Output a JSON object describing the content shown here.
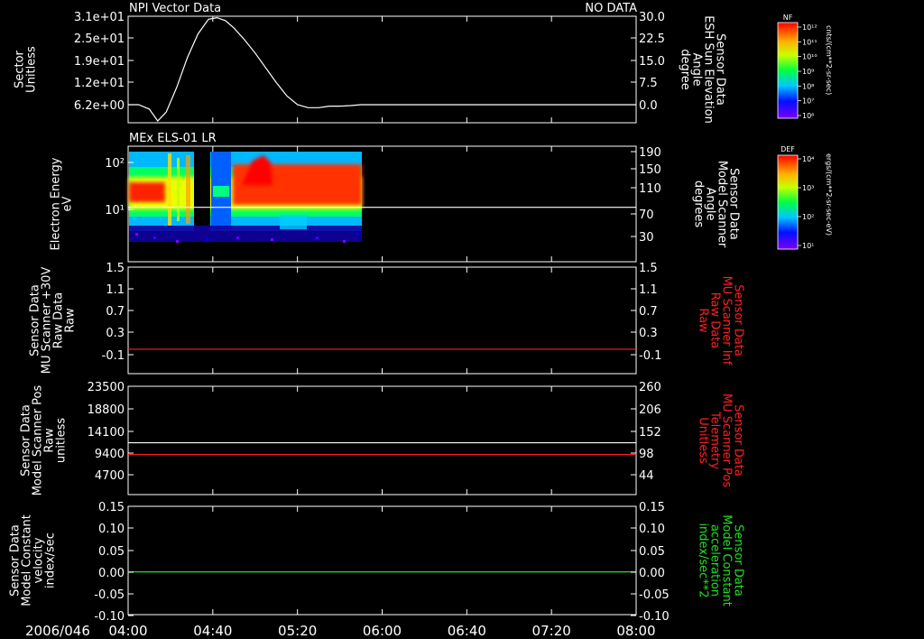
{
  "footer": {
    "date": "2006/046",
    "time_ticks": [
      "04:00",
      "04:40",
      "05:20",
      "06:00",
      "06:40",
      "07:20",
      "08:00"
    ]
  },
  "panels": [
    {
      "id": "panel1",
      "title_left": "NPI Vector Data",
      "title_right": "NO DATA",
      "left_axis": {
        "label": [
          "Sector",
          "Unitless"
        ],
        "ticks": [
          "3.1e+01",
          "2.5e+01",
          "1.9e+01",
          "1.2e+01",
          "6.2e+00"
        ],
        "color": "#ffffff"
      },
      "right_axis": {
        "label": [
          "Sensor Data",
          "ESH Sun Elevation",
          "Angle",
          "degree"
        ],
        "ticks": [
          "30.0",
          "22.5",
          "15.0",
          "7.5",
          "0.0"
        ],
        "color": "#ffffff"
      }
    },
    {
      "id": "panel2",
      "title_left": "MEx ELS-01 LR",
      "left_axis": {
        "label": [
          "Electron Energy",
          "eV"
        ],
        "ticks": [
          "10²",
          "10¹"
        ],
        "color": "#ffffff"
      },
      "right_axis": {
        "label": [
          "Sensor Data",
          "Model Scanner",
          "Angle",
          "degrees"
        ],
        "ticks": [
          "190",
          "150",
          "110",
          "70",
          "30"
        ],
        "color": "#ffffff"
      }
    },
    {
      "id": "panel3",
      "left_axis": {
        "label": [
          "Sensor Data",
          "MU Scanner +30V",
          "Raw Data",
          "Raw"
        ],
        "ticks": [
          "1.5",
          "1.1",
          "0.7",
          "0.3",
          "-0.1"
        ],
        "color": "#ffffff"
      },
      "right_axis": {
        "label": [
          "Sensor Data",
          "MU Scanner Inf",
          "Raw Data",
          "Raw"
        ],
        "ticks": [
          "1.5",
          "1.1",
          "0.7",
          "0.3",
          "-0.1"
        ],
        "color": "#ff2020"
      }
    },
    {
      "id": "panel4",
      "left_axis": {
        "label": [
          "Sensor Data",
          "Model Scanner Pos",
          "Raw",
          "unitless"
        ],
        "ticks": [
          "23500",
          "18800",
          "14100",
          "9400",
          "4700"
        ],
        "color": "#ffffff"
      },
      "right_axis": {
        "label": [
          "Sensor Data",
          "MU Scanner Pos",
          "Telemetry",
          "Unitless"
        ],
        "ticks": [
          "260",
          "206",
          "152",
          "98",
          "44"
        ],
        "color": "#ff2020"
      }
    },
    {
      "id": "panel5",
      "left_axis": {
        "label": [
          "Sensor Data",
          "Model Constant",
          "velocity",
          "index/sec"
        ],
        "ticks": [
          "0.15",
          "0.10",
          "0.05",
          "0.00",
          "-0.05",
          "-0.10"
        ],
        "color": "#ffffff"
      },
      "right_axis": {
        "label": [
          "Sensor Data",
          "Model Constant",
          "acceleration",
          "index/sec**2"
        ],
        "ticks": [
          "0.15",
          "0.10",
          "0.05",
          "0.00",
          "-0.05",
          "-0.10"
        ],
        "color": "#20e020"
      }
    }
  ],
  "colorbars": [
    {
      "name": "NF",
      "units": "cnts/(cm**2-sr-sec)",
      "tick_labels": [
        "10¹²",
        "10¹¹",
        "10¹⁰",
        "10⁹",
        "10⁸",
        "10⁷",
        "10⁶"
      ]
    },
    {
      "name": "DEF",
      "units": "ergs/(cm**2-sr-sec-eV)",
      "tick_labels": [
        "10⁴",
        "10³",
        "10²",
        "10¹"
      ]
    }
  ],
  "colors": {
    "background": "#000000",
    "axis": "#ffffff",
    "red_trace": "#ff2020",
    "green_trace": "#20e020"
  },
  "chart_data": [
    {
      "type": "line",
      "panel": "panel1",
      "title": "NPI Vector Data",
      "xlabel": "",
      "ylabel": "Sensor Data ESH Sun Elevation Angle degree",
      "ylim": [
        -4,
        30
      ],
      "series": [
        {
          "name": "ESH Sun Elevation Angle",
          "x": [
            "04:00",
            "04:05",
            "04:10",
            "04:14",
            "04:18",
            "04:23",
            "04:28",
            "04:33",
            "04:38",
            "04:42",
            "04:46",
            "04:50",
            "04:55",
            "05:00",
            "05:05",
            "05:10",
            "05:15",
            "05:20",
            "05:25",
            "05:30",
            "05:35",
            "05:40",
            "05:45",
            "05:50",
            "06:00",
            "07:00",
            "08:00"
          ],
          "y": [
            0.0,
            0.0,
            -1.5,
            -5.5,
            -2.5,
            6.0,
            16.0,
            24.0,
            29.0,
            29.5,
            28.5,
            26.0,
            22.0,
            17.5,
            12.5,
            7.5,
            3.0,
            0.0,
            -1.0,
            -1.0,
            -0.5,
            -0.5,
            -0.3,
            0.0,
            0.0,
            0.0,
            0.0
          ]
        }
      ]
    },
    {
      "type": "heatmap",
      "panel": "panel2",
      "title": "MEx ELS-01 LR",
      "ylabel": "Electron Energy eV",
      "colorbar": "DEF",
      "time_range": [
        "04:00",
        "05:50"
      ],
      "energy_range_eV": [
        2,
        150
      ],
      "series": [
        {
          "name": "Model Scanner Angle",
          "x": [
            "04:00",
            "08:00"
          ],
          "y": [
            85,
            85
          ]
        }
      ]
    },
    {
      "type": "line",
      "panel": "panel3",
      "ylim": [
        -0.3,
        1.5
      ],
      "series": [
        {
          "name": "MU Scanner Inf Raw Data",
          "x": [
            "04:00",
            "08:00"
          ],
          "y": [
            0.0,
            0.0
          ]
        }
      ]
    },
    {
      "type": "line",
      "panel": "panel4",
      "ylim": [
        0,
        23500
      ],
      "series": [
        {
          "name": "Model Scanner Pos Raw",
          "x": [
            "04:00",
            "08:00"
          ],
          "y": [
            11500,
            11500
          ]
        },
        {
          "name": "MU Scanner Pos Telemetry",
          "x": [
            "04:00",
            "08:00"
          ],
          "y": [
            9000,
            9000
          ]
        }
      ]
    },
    {
      "type": "line",
      "panel": "panel5",
      "ylim": [
        -0.1,
        0.15
      ],
      "series": [
        {
          "name": "Model Constant acceleration",
          "x": [
            "04:00",
            "08:00"
          ],
          "y": [
            0.0,
            0.0
          ]
        }
      ]
    }
  ]
}
